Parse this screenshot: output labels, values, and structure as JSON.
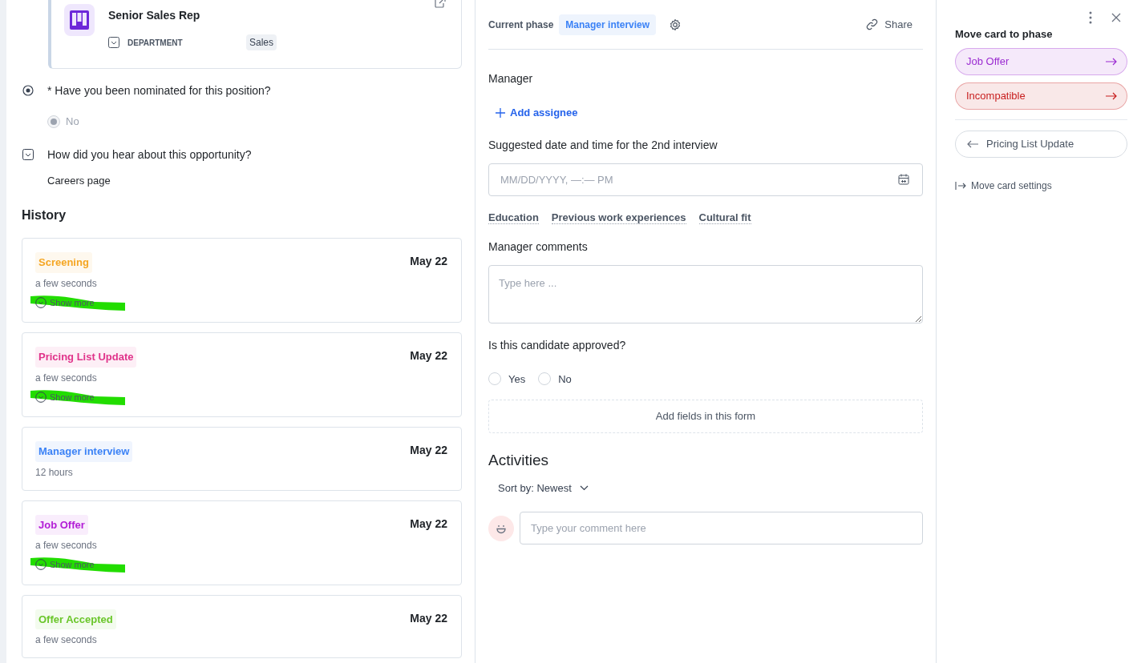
{
  "record_card": {
    "title": "Senior Sales Rep",
    "field_label": "DEPARTMENT",
    "field_value": "Sales"
  },
  "questions": [
    {
      "kind": "radio",
      "label": "* Have you been nominated for this position?",
      "options": [
        {
          "label": "No",
          "selected": true
        }
      ]
    },
    {
      "kind": "select",
      "label": "How did you hear about this opportunity?",
      "answer": "Careers page"
    }
  ],
  "history": {
    "title": "History",
    "items": [
      {
        "phase": "Screening",
        "color": "#f5a623",
        "elapsed": "a few seconds",
        "date": "May 22",
        "show_more": "Show more",
        "highlighted": true
      },
      {
        "phase": "Pricing List Update",
        "color": "#e0338a",
        "elapsed": "a few seconds",
        "date": "May 22",
        "show_more": "Show more",
        "highlighted": true
      },
      {
        "phase": "Manager interview",
        "color": "#3b82f6",
        "elapsed": "12 hours",
        "date": "May 22"
      },
      {
        "phase": "Job Offer",
        "color": "#b31ed6",
        "elapsed": "a few seconds",
        "date": "May 22",
        "show_more": "Show more",
        "highlighted": true
      },
      {
        "phase": "Offer Accepted",
        "color": "#6ac62a",
        "elapsed": "a few seconds",
        "date": "May 22"
      }
    ]
  },
  "phase_form": {
    "current_phase_label": "Current phase",
    "current_phase": "Manager interview",
    "share": "Share",
    "manager_label": "Manager",
    "add_assignee": "Add assignee",
    "date_label": "Suggested date and time for the 2nd interview",
    "date_placeholder": "MM/DD/YYYY, —:— PM",
    "links": [
      "Education",
      "Previous work experiences",
      "Cultural fit"
    ],
    "comments_label": "Manager comments",
    "comments_placeholder": "Type here ...",
    "approval_label": "Is this candidate approved?",
    "approval_options": [
      {
        "label": "Yes",
        "selected": false
      },
      {
        "label": "No",
        "selected": false
      }
    ],
    "add_fields": "Add fields in this form"
  },
  "activities": {
    "title": "Activities",
    "sort": "Sort by: Newest",
    "comment_placeholder": "Type your comment here"
  },
  "move_panel": {
    "title": "Move card to phase",
    "targets": [
      {
        "label": "Job Offer",
        "color": "#9b2bd1"
      },
      {
        "label": "Incompatible",
        "color": "#c81e1e"
      }
    ],
    "previous": "Pricing List Update",
    "settings": "Move card settings"
  }
}
